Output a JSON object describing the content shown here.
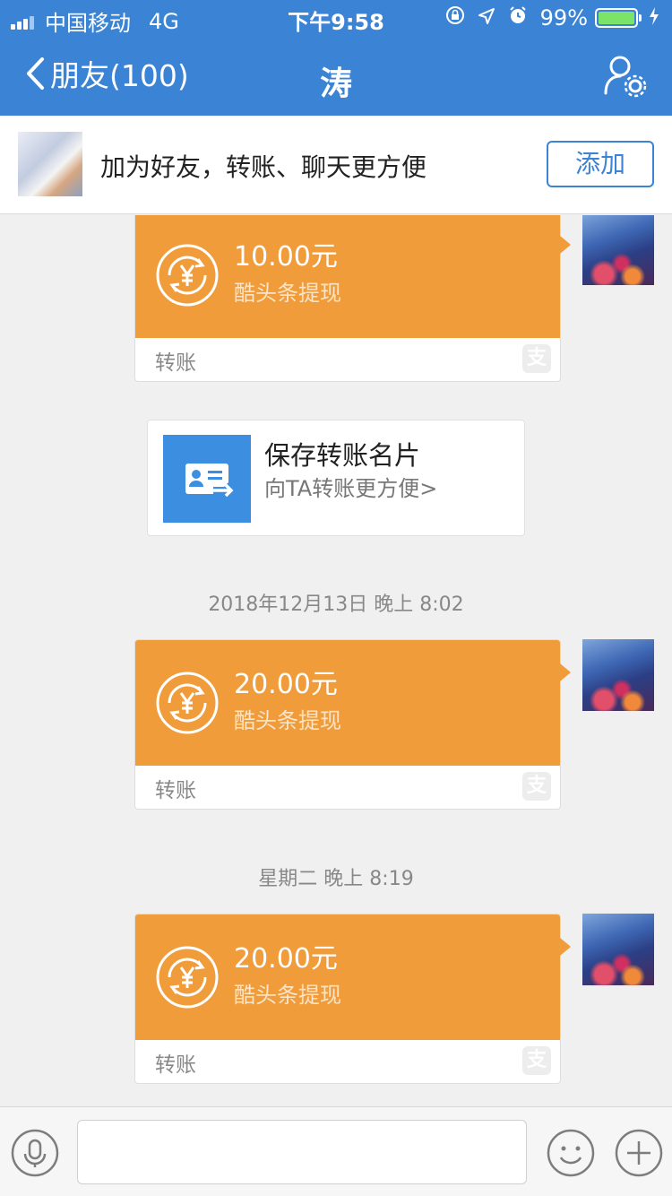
{
  "status_bar": {
    "carrier": "中国移动",
    "network": "4G",
    "time": "下午9:58",
    "battery": "99%",
    "battery_level": 0.99
  },
  "nav": {
    "back_label": "朋友(100)",
    "title": "涛",
    "settings_icon": "person-gear-icon"
  },
  "add_friend_bar": {
    "message": "加为好友，转账、聊天更方便",
    "button_label": "添加"
  },
  "messages": [
    {
      "type": "transfer",
      "amount": "10.00元",
      "description": "酷头条提现",
      "footer": "转账"
    },
    {
      "type": "card",
      "title": "保存转账名片",
      "subtitle": "向TA转账更方便>"
    },
    {
      "type": "timestamp",
      "text": "2018年12月13日 晚上 8:02"
    },
    {
      "type": "transfer",
      "amount": "20.00元",
      "description": "酷头条提现",
      "footer": "转账"
    },
    {
      "type": "timestamp",
      "text": "星期二 晚上 8:19"
    },
    {
      "type": "transfer",
      "amount": "20.00元",
      "description": "酷头条提现",
      "footer": "转账"
    }
  ],
  "colors": {
    "nav_blue": "#3b83d4",
    "transfer_orange": "#f09c3a",
    "card_blue": "#3b8ee0"
  }
}
